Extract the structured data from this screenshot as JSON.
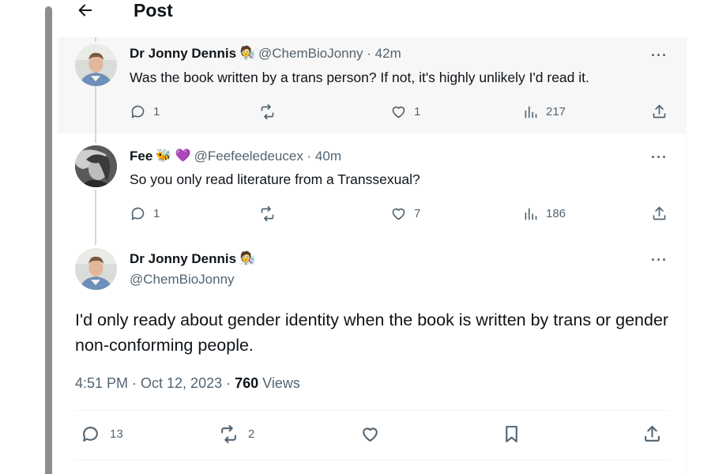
{
  "header": {
    "title": "Post"
  },
  "replies": [
    {
      "name": "Dr Jonny Dennis",
      "emoji": "🧑‍🔬",
      "handle_time": "@ChemBioJonny · 42m",
      "text": "Was the book written by a trans person? If not, it's highly unlikely I'd read it.",
      "replies": "1",
      "reposts": "",
      "likes": "1",
      "views": "217"
    },
    {
      "name": "Fee",
      "emoji": "🐝 💜",
      "handle_time": "@Feefeeledeucex · 40m",
      "text": "So you only read literature from a Transsexual?",
      "replies": "1",
      "reposts": "",
      "likes": "7",
      "views": "186"
    }
  ],
  "main_post": {
    "name": "Dr Jonny Dennis",
    "emoji": "🧑‍🔬",
    "handle": "@ChemBioJonny",
    "text": "I'd only ready about gender identity when the book is written by trans or gender non-conforming people.",
    "time": "4:51 PM · Oct 12, 2023 · ",
    "views_count": "760",
    "views_label": " Views",
    "replies": "13",
    "reposts": "2"
  },
  "more_label": "···",
  "colors": {
    "text": "#0f1419",
    "secondary": "#536471",
    "highlight": "#f7f7f7"
  }
}
